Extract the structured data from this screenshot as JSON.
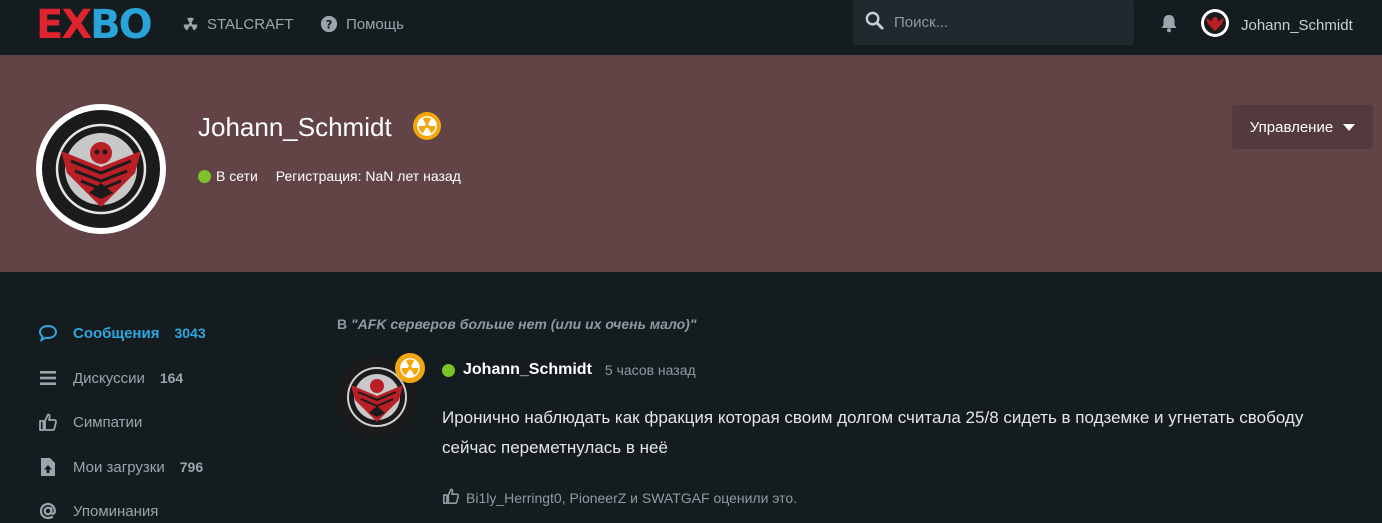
{
  "header": {
    "logo": [
      "E",
      "X",
      "B",
      "O"
    ],
    "nav": [
      {
        "label": "STALCRAFT",
        "icon": "radiation-icon"
      },
      {
        "label": "Помощь",
        "icon": "question-circle-icon"
      }
    ],
    "search": {
      "placeholder": "Поиск..."
    },
    "user": {
      "name": "Johann_Schmidt"
    }
  },
  "profile": {
    "name": "Johann_Schmidt",
    "status": "В сети",
    "registration": "Регистрация: NaN лет назад",
    "manage_button": "Управление"
  },
  "sidebar": {
    "items": [
      {
        "label": "Сообщения",
        "count": "3043",
        "icon": "comment-bubble-icon"
      },
      {
        "label": "Дискуссии",
        "count": "164",
        "icon": "list-icon"
      },
      {
        "label": "Симпатии",
        "count": "",
        "icon": "thumbs-up-icon"
      },
      {
        "label": "Мои загрузки",
        "count": "796",
        "icon": "file-upload-icon"
      },
      {
        "label": "Упоминания",
        "count": "",
        "icon": "at-sign-icon"
      }
    ]
  },
  "post": {
    "context_prefix": "В",
    "thread_title": "\"AFK серверов больше нет (или их очень мало)\"",
    "author": "Johann_Schmidt",
    "time": "5 часов назад",
    "body": "Иронично наблюдать как фракция которая своим долгом считала 25/8 сидеть в подземке и угнетать свободу сейчас переметнулась в неё",
    "likes": "Bi1ly_Herringt0, PioneerZ и SWATGAF оценили это."
  },
  "colors": {
    "accent": "#2ea7e0",
    "banner": "#624446",
    "online": "#7cc229",
    "badge": "#f5a60c",
    "logo_red": "#e0242f",
    "logo_blue": "#2aa3d9"
  }
}
